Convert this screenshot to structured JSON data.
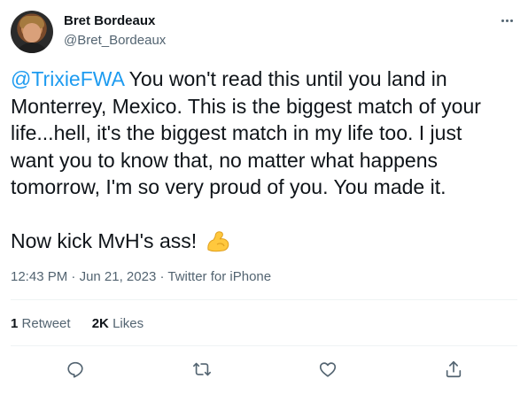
{
  "user": {
    "display_name": "Bret Bordeaux",
    "handle": "@Bret_Bordeaux",
    "avatar_icon": "profile-photo"
  },
  "more_icon": "ellipsis-icon",
  "tweet": {
    "mention": "@TrixieFWA",
    "paragraph_1": " You won't read this until you land in Monterrey, Mexico. This is the biggest match of your life...hell, it's the biggest match in my life too. I just want you to know that, no matter what happens tomorrow, I'm so very proud of you. You made it.",
    "paragraph_2": "Now kick MvH's ass! ",
    "emoji": "flexed-biceps-emoji"
  },
  "meta": {
    "time": "12:43 PM",
    "separator_1": " · ",
    "date": "Jun 21, 2023",
    "separator_2": " · ",
    "source": "Twitter for iPhone"
  },
  "stats": {
    "retweets_count": "1",
    "retweets_label": "Retweet",
    "likes_count": "2K",
    "likes_label": "Likes"
  },
  "actions": {
    "reply_icon": "reply-icon",
    "retweet_icon": "retweet-icon",
    "like_icon": "heart-icon",
    "share_icon": "share-icon"
  },
  "colors": {
    "accent": "#1d9bf0",
    "text": "#0f1419",
    "secondary": "#536471",
    "divider": "#eff3f4"
  }
}
